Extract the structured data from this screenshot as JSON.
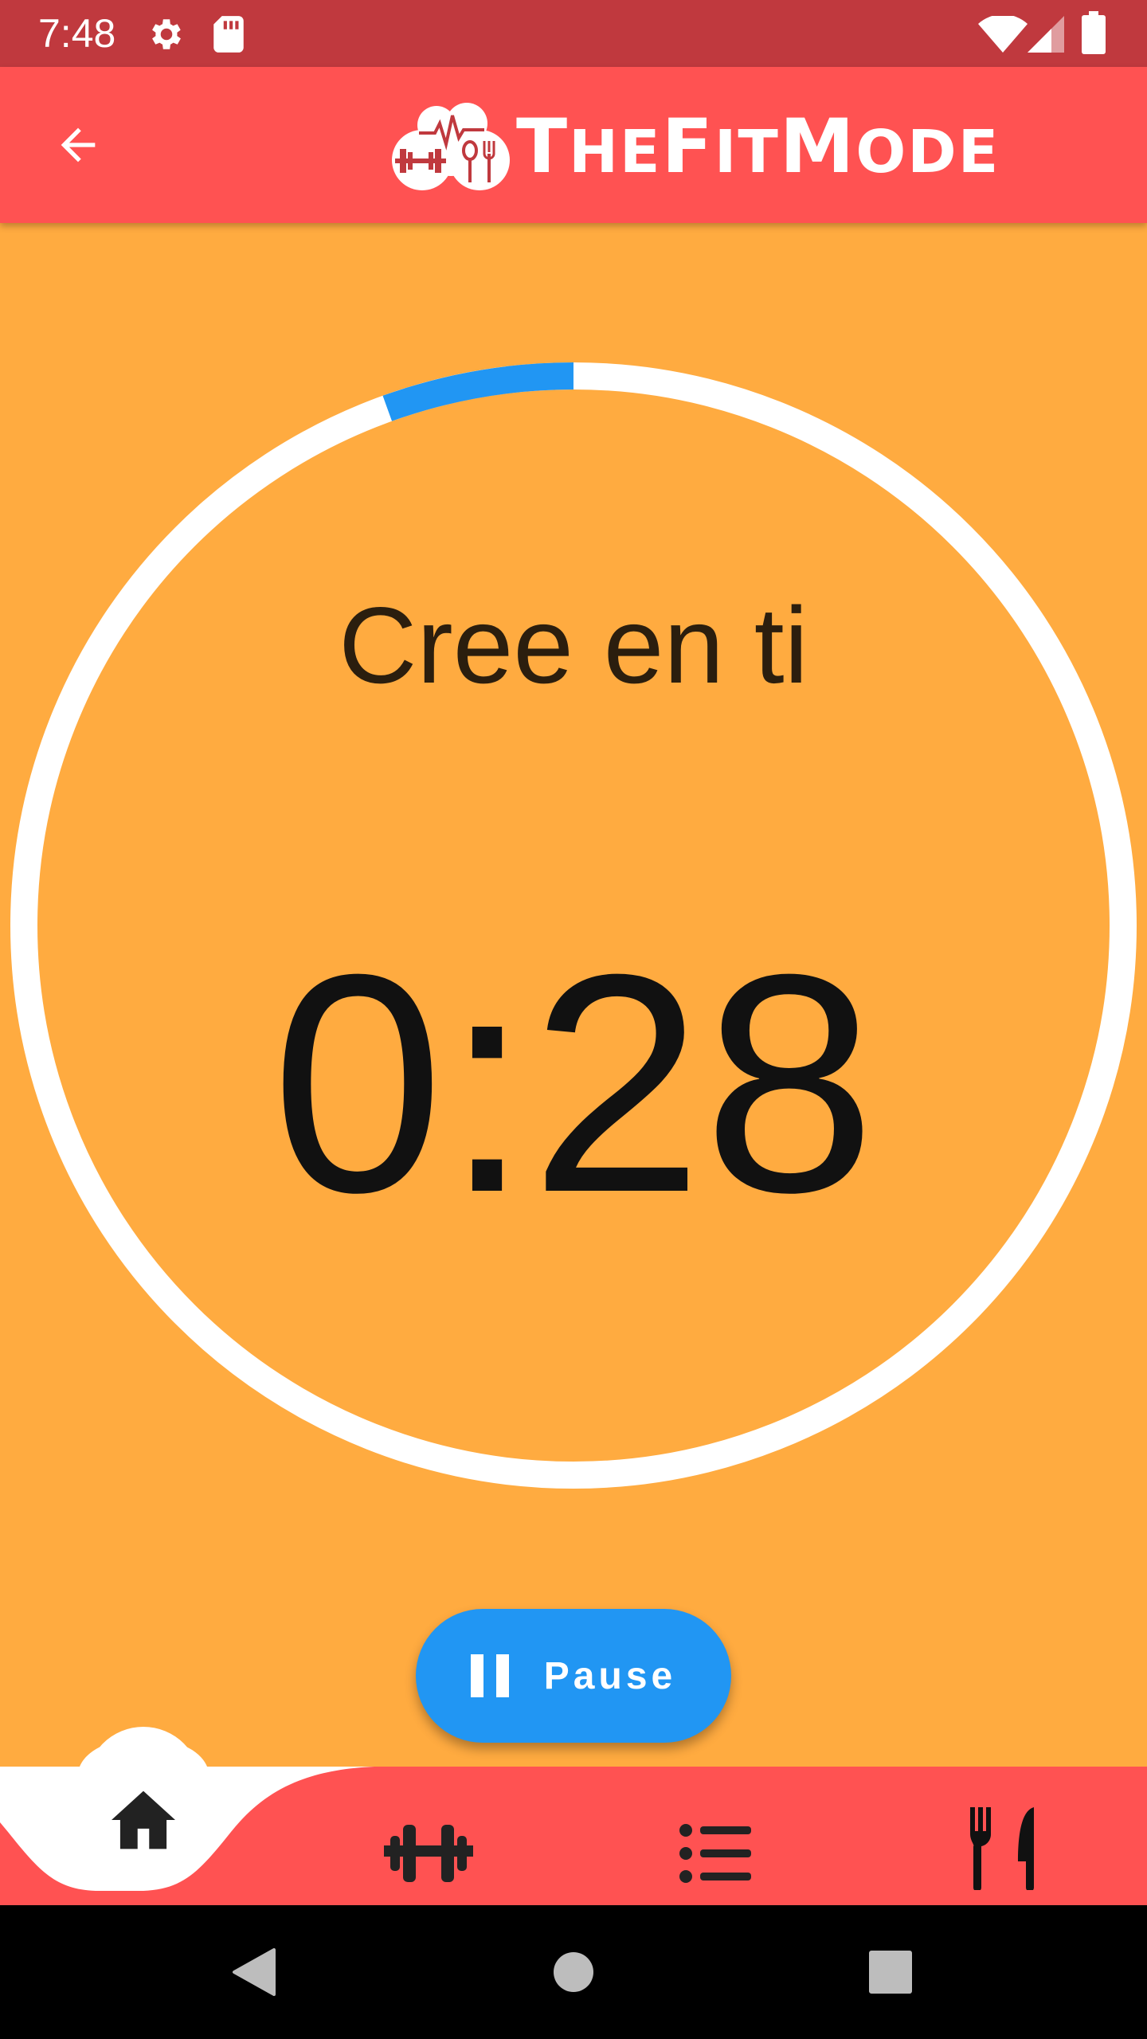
{
  "status_bar": {
    "time": "7:48",
    "icons": [
      "settings-icon",
      "sd-card-icon",
      "wifi-icon",
      "signal-icon",
      "battery-icon"
    ]
  },
  "app_bar": {
    "back_icon": "arrow-back-icon",
    "logo_text_large_1": "T",
    "logo_text_small_1": "HE",
    "logo_text_large_2": "F",
    "logo_text_small_2": "IT",
    "logo_text_large_3": "M",
    "logo_text_small_3": "ODE",
    "logo_alt": "TheFitMode"
  },
  "main": {
    "motivation": "Cree en ti",
    "timer": "0:28",
    "progress": 0.055,
    "pause_label": "Pause"
  },
  "bottom_nav": {
    "items": [
      {
        "icon": "home-icon",
        "active": true
      },
      {
        "icon": "dumbbell-icon",
        "active": false
      },
      {
        "icon": "list-icon",
        "active": false
      },
      {
        "icon": "fork-knife-icon",
        "active": false
      }
    ]
  },
  "system_nav": {
    "buttons": [
      "back-triangle-icon",
      "home-circle-icon",
      "recents-square-icon"
    ]
  },
  "colors": {
    "status_bar": "#C0393E",
    "app_bar": "#FF5252",
    "background": "#FFAB40",
    "progress": "#2196F3",
    "ring": "#FFFFFF",
    "nav_bar": "#FF5252"
  }
}
